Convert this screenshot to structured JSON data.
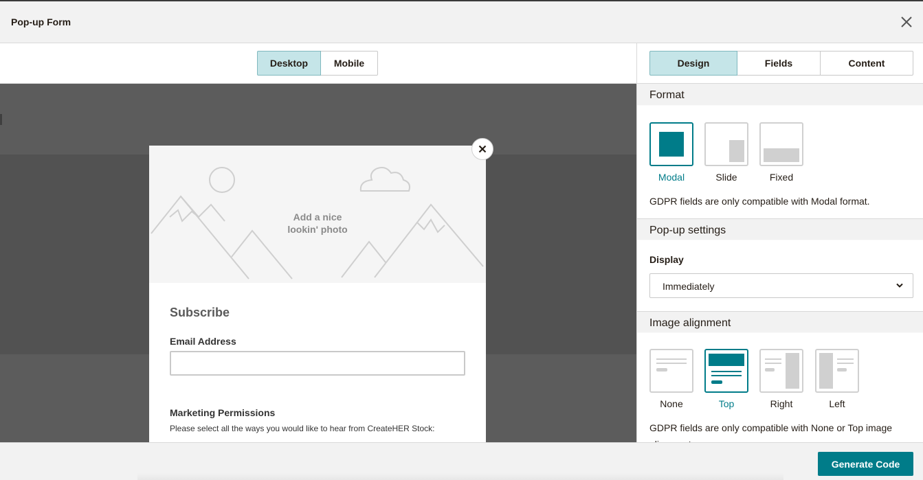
{
  "window": {
    "title": "Pop-up Form"
  },
  "device_tabs": {
    "desktop": "Desktop",
    "mobile": "Mobile",
    "active": "desktop"
  },
  "popup": {
    "photo_placeholder_line1": "Add a nice",
    "photo_placeholder_line2": "lookin' photo",
    "title": "Subscribe",
    "email_label": "Email Address",
    "email_value": "",
    "marketing_title": "Marketing Permissions",
    "marketing_desc": "Please select all the ways you would like to hear from CreateHER Stock:"
  },
  "panel_tabs": {
    "design": "Design",
    "fields": "Fields",
    "content": "Content",
    "active": "design"
  },
  "format": {
    "heading": "Format",
    "options": [
      {
        "label": "Modal",
        "icon": "modal-format-icon"
      },
      {
        "label": "Slide",
        "icon": "slide-format-icon"
      },
      {
        "label": "Fixed",
        "icon": "fixed-format-icon"
      }
    ],
    "selected": "Modal",
    "note": "GDPR fields are only compatible with Modal format."
  },
  "popup_settings": {
    "heading": "Pop-up settings",
    "display_label": "Display",
    "display_value": "Immediately"
  },
  "image_alignment": {
    "heading": "Image alignment",
    "options": [
      {
        "label": "None",
        "icon": "align-none-icon"
      },
      {
        "label": "Top",
        "icon": "align-top-icon"
      },
      {
        "label": "Right",
        "icon": "align-right-icon"
      },
      {
        "label": "Left",
        "icon": "align-left-icon"
      }
    ],
    "selected": "Top",
    "note": "GDPR fields are only compatible with None or Top image alignment."
  },
  "footer": {
    "generate_label": "Generate Code"
  },
  "colors": {
    "accent": "#007c89",
    "active_tab": "#c5e5e8",
    "overlay": "#5c5c5c"
  }
}
